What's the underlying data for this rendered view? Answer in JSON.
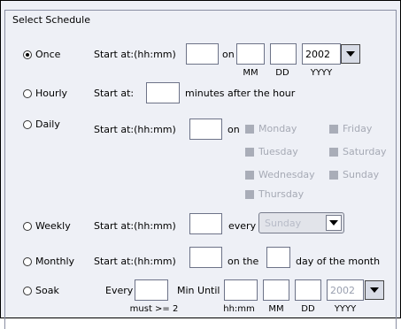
{
  "group_title": "Select Schedule",
  "once": {
    "label": "Once",
    "start_label": "Start at:(hh:mm)",
    "time_value": "",
    "on_label": "on",
    "month_value": "",
    "day_value": "",
    "year_value": "2002",
    "mm_label": "MM",
    "dd_label": "DD",
    "yyyy_label": "YYYY"
  },
  "hourly": {
    "label": "Hourly",
    "start_label": "Start at:",
    "minutes_value": "",
    "after_label": "minutes after the hour"
  },
  "daily": {
    "label": "Daily",
    "start_label": "Start at:(hh:mm)",
    "time_value": "",
    "on_label": "on",
    "days": {
      "monday": "Monday",
      "tuesday": "Tuesday",
      "wednesday": "Wednesday",
      "thursday": "Thursday",
      "friday": "Friday",
      "saturday": "Saturday",
      "sunday": "Sunday"
    }
  },
  "weekly": {
    "label": "Weekly",
    "start_label": "Start at:(hh:mm)",
    "time_value": "",
    "every_label": "every",
    "day_selected": "Sunday"
  },
  "monthly": {
    "label": "Monthly",
    "start_label": "Start at:(hh:mm)",
    "time_value": "",
    "on_the_label": "on the",
    "day_value": "",
    "day_of_month_label": "day of the month"
  },
  "soak": {
    "label": "Soak",
    "every_label": "Every",
    "every_value": "",
    "min_until_label": "Min Until",
    "time_value": "",
    "month_value": "",
    "day_value": "",
    "year_value": "2002",
    "must_label": "must >= 2",
    "hhmm_label": "hh:mm",
    "mm_label": "MM",
    "dd_label": "DD",
    "yyyy_label": "YYYY"
  }
}
